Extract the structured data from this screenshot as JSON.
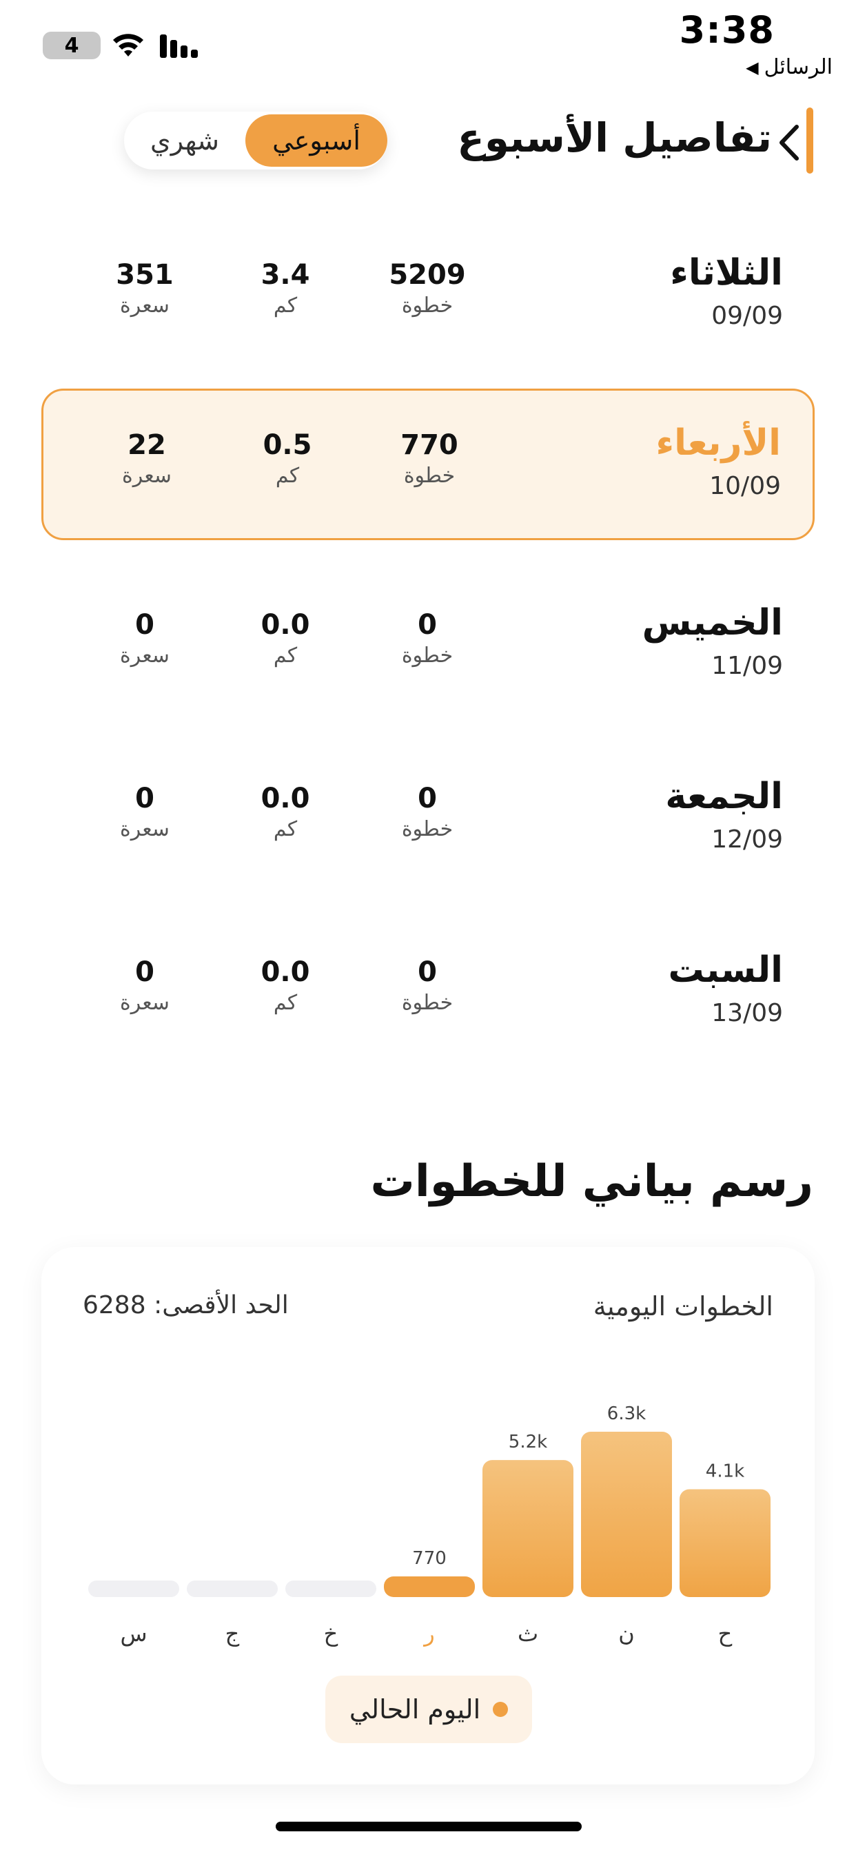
{
  "status_bar": {
    "time": "3:38",
    "back_app": "الرسائل",
    "battery_level": "4"
  },
  "header": {
    "title": "تفاصيل الأسبوع",
    "toggle": {
      "weekly": "أسبوعي",
      "monthly": "شهري",
      "selected": "weekly"
    }
  },
  "days": [
    {
      "name": "الثلاثاء",
      "date": "09/09",
      "steps": "5209",
      "steps_unit": "خطوة",
      "km": "3.4",
      "km_unit": "كم",
      "calories": "351",
      "calories_unit": "سعرة",
      "is_today": false
    },
    {
      "name": "الأربعاء",
      "date": "10/09",
      "steps": "770",
      "steps_unit": "خطوة",
      "km": "0.5",
      "km_unit": "كم",
      "calories": "22",
      "calories_unit": "سعرة",
      "is_today": true
    },
    {
      "name": "الخميس",
      "date": "11/09",
      "steps": "0",
      "steps_unit": "خطوة",
      "km": "0.0",
      "km_unit": "كم",
      "calories": "0",
      "calories_unit": "سعرة",
      "is_today": false
    },
    {
      "name": "الجمعة",
      "date": "12/09",
      "steps": "0",
      "steps_unit": "خطوة",
      "km": "0.0",
      "km_unit": "كم",
      "calories": "0",
      "calories_unit": "سعرة",
      "is_today": false
    },
    {
      "name": "السبت",
      "date": "13/09",
      "steps": "0",
      "steps_unit": "خطوة",
      "km": "0.0",
      "km_unit": "كم",
      "calories": "0",
      "calories_unit": "سعرة",
      "is_today": false
    }
  ],
  "chart_section": {
    "title": "رسم بياني للخطوات",
    "card_label": "الخطوات اليومية",
    "max_label": "الحد الأقصى: 6288",
    "legend": "اليوم الحالي"
  },
  "chart_data": {
    "type": "bar",
    "categories": [
      "ح",
      "ن",
      "ث",
      "ر",
      "خ",
      "ج",
      "س"
    ],
    "values": [
      4100,
      6288,
      5209,
      770,
      0,
      0,
      0
    ],
    "data_labels": [
      "4.1k",
      "6.3k",
      "5.2k",
      "770",
      "",
      "",
      ""
    ],
    "highlight_index": 3,
    "ymax": 6288,
    "direction": "right-to-left",
    "colors": {
      "bar": "#f0a042",
      "bar_light": "#f5c581",
      "empty": "#f0f0f3",
      "highlight_label": "#f0a042"
    }
  },
  "colors": {
    "accent": "#f0a042",
    "today_bg": "#fdf3e6"
  }
}
